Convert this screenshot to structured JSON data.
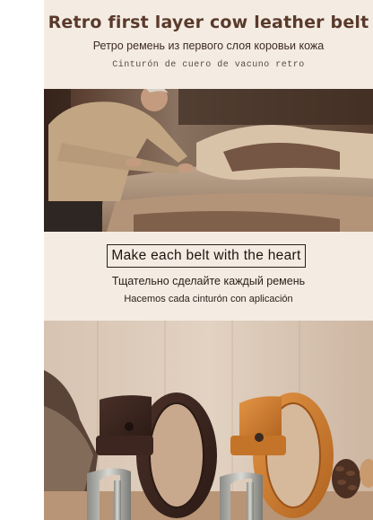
{
  "header": {
    "title": "Retro first layer cow leather belt",
    "subtitle_ru": "Ретро ремень из первого слоя коровьи кожа",
    "subtitle_es": "Cinturón de cuero de vacuno retro"
  },
  "middle": {
    "boxed_heading": "Make each belt with the heart",
    "line_ru": "Тщательно сделайте каждый ремень",
    "line_es": "Hacemos cada cinturón con aplicación"
  },
  "colors": {
    "panel_background": "#f4ece3",
    "title_color": "#5a3a2b",
    "dark_belt": "#3b2620",
    "light_belt": "#c87a2e"
  },
  "images": {
    "top_photo": "craftsman-cutting-leather-photo",
    "bottom_photo": "two-leather-belts-photo"
  }
}
